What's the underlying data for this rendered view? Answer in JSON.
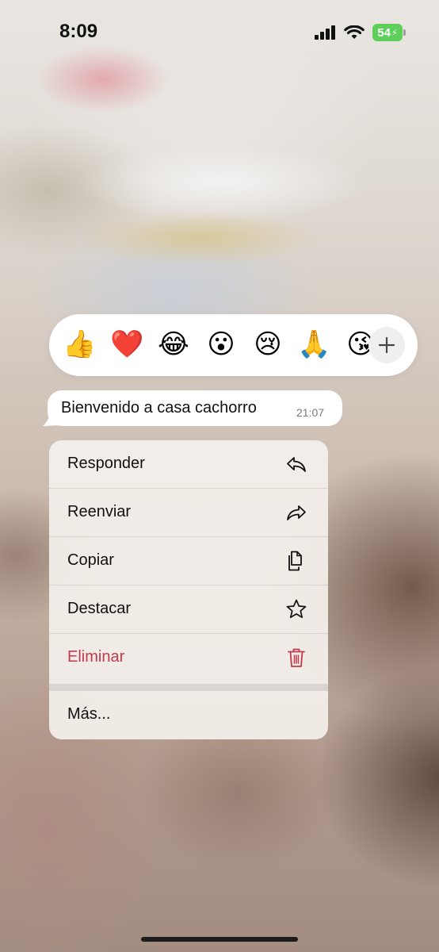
{
  "status_bar": {
    "time": "8:09",
    "battery": "54"
  },
  "reactions": {
    "emojis": [
      {
        "name": "thumbs-up",
        "glyph": "👍"
      },
      {
        "name": "red-heart",
        "glyph": "❤️"
      },
      {
        "name": "tears-of-joy",
        "glyph": "😂"
      },
      {
        "name": "surprised",
        "glyph": "😮"
      },
      {
        "name": "crying",
        "glyph": "😢"
      },
      {
        "name": "folded-hands",
        "glyph": "🙏"
      },
      {
        "name": "heart-kiss",
        "glyph": "😘"
      }
    ],
    "more_icon": "plus-icon"
  },
  "message": {
    "text": "Bienvenido a casa cachorro",
    "time": "21:07"
  },
  "menu": {
    "items": [
      {
        "label": "Responder",
        "icon": "reply-icon"
      },
      {
        "label": "Reenviar",
        "icon": "forward-icon"
      },
      {
        "label": "Copiar",
        "icon": "copy-icon"
      },
      {
        "label": "Destacar",
        "icon": "star-icon"
      },
      {
        "label": "Eliminar",
        "icon": "trash-icon"
      }
    ],
    "more_label": "Más..."
  },
  "colors": {
    "danger": "#c13b4d",
    "battery": "#5fcf5b"
  }
}
